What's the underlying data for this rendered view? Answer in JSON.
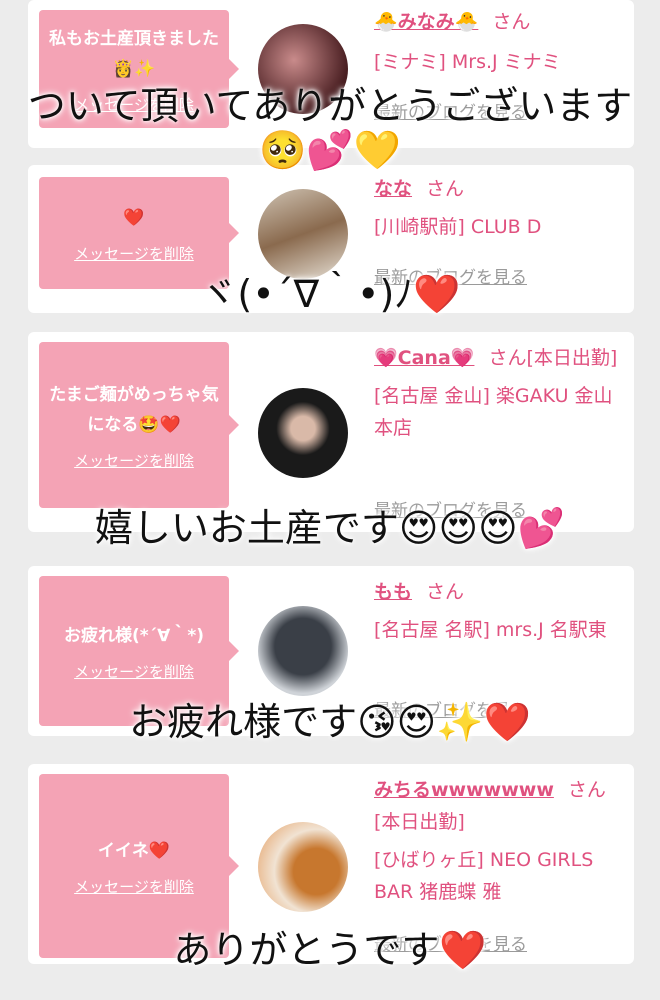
{
  "cards": [
    {
      "message": "私もお土産頂きました👸✨",
      "delete_label": "メッセージを削除",
      "name": "🐣みなみ🐣",
      "san": "さん",
      "shop": "[ミナミ] Mrs.J ミナミ",
      "blog": "最新のブログを見る"
    },
    {
      "message": "❤️",
      "delete_label": "メッセージを削除",
      "name": "なな",
      "san": "さん",
      "shop": "[川崎駅前] CLUB D",
      "blog": "最新のブログを見る"
    },
    {
      "message": "たまご麺がめっちゃ気になる🤩❤️",
      "delete_label": "メッセージを削除",
      "name": "💗Cana💗",
      "san": "さん[本日出勤]",
      "shop": "[名古屋 金山] 楽GAKU 金山本店",
      "blog": "最新のブログを見る"
    },
    {
      "message": "お疲れ様(*´∀｀*)",
      "delete_label": "メッセージを削除",
      "name": "もも",
      "san": "さん",
      "shop": "[名古屋 名駅] mrs.J 名駅東",
      "blog": "最新のブログを見る"
    },
    {
      "message": "イイネ❤️",
      "delete_label": "メッセージを削除",
      "name": "みちるwwwwwww",
      "san": "さん[本日出勤]",
      "shop": "[ひばりヶ丘] NEO GIRLS BAR 猪鹿蝶 雅",
      "blog": "最新のブログを見る"
    }
  ],
  "overlays": [
    "ついて頂いてありがとうございます🥺💕💛",
    "ヾ(•´∇｀•)ﾉ❤️",
    "嬉しいお土産です😍😍😍💕",
    "お疲れ様です😘😍✨❤️",
    "ありがとうです❤️"
  ],
  "colors": {
    "accent": "#e0517f",
    "bubble": "#f4a3b5",
    "background": "#ececec"
  }
}
